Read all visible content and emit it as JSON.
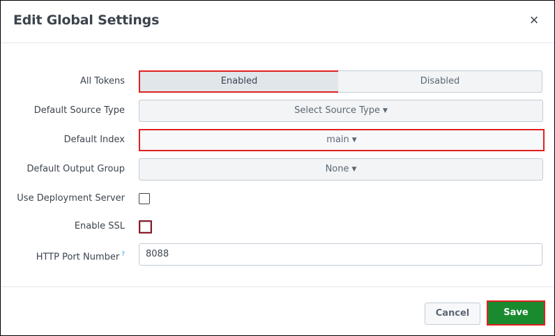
{
  "dialog": {
    "title": "Edit Global Settings",
    "close_icon": "close-icon"
  },
  "fields": {
    "all_tokens": {
      "label": "All Tokens",
      "options": [
        "Enabled",
        "Disabled"
      ],
      "selected": "Enabled"
    },
    "default_source_type": {
      "label": "Default Source Type",
      "value": "Select Source Type"
    },
    "default_index": {
      "label": "Default Index",
      "value": "main"
    },
    "default_output_group": {
      "label": "Default Output Group",
      "value": "None"
    },
    "use_deployment_server": {
      "label": "Use Deployment Server",
      "checked": false
    },
    "enable_ssl": {
      "label": "Enable SSL",
      "checked": false
    },
    "http_port": {
      "label": "HTTP Port Number",
      "help": "?",
      "value": "8088"
    }
  },
  "footer": {
    "cancel_label": "Cancel",
    "save_label": "Save"
  },
  "colors": {
    "highlight": "#e02020",
    "save": "#1a8a2f",
    "help": "#1a9fd8"
  }
}
